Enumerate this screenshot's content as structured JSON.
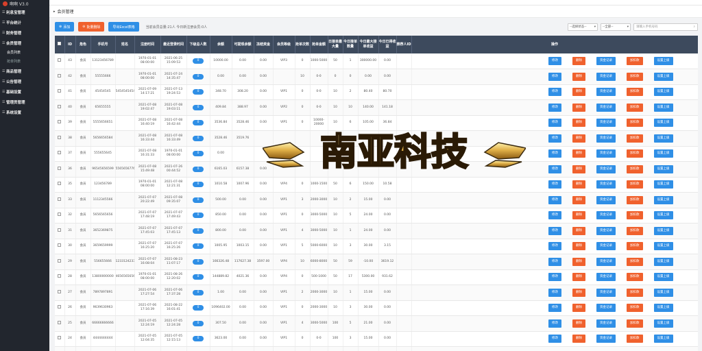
{
  "sidebar": {
    "brand": "啊啊 V3.0",
    "items": [
      {
        "label": "利息宝管理"
      },
      {
        "label": "平台统计"
      },
      {
        "label": "财务管理"
      },
      {
        "label": "会员管理"
      },
      {
        "label": "商品管理"
      },
      {
        "label": "公告管理"
      },
      {
        "label": "基础设置"
      },
      {
        "label": "管理员管理"
      },
      {
        "label": "系统设置"
      }
    ],
    "subitems": [
      {
        "label": "会员列表"
      },
      {
        "label": "抢单列表"
      }
    ]
  },
  "breadcrumb": {
    "title": "会员管理"
  },
  "toolbar": {
    "add_label": "添加",
    "batch_delete_label": "批量删除",
    "export_label": "导出Excel表格",
    "stats_text": "当前会员总量:21人   今日新注册会员:0人",
    "status_select": "--选择状态--",
    "all_select": "--全部--",
    "search_placeholder": "请输入手机号码"
  },
  "table": {
    "headers": [
      "",
      "ID",
      "角色",
      "手机号",
      "姓名",
      "注册时间",
      "最近登录时间",
      "下级总人数",
      "余额",
      "可提现余额",
      "冻结资金",
      "会员等级",
      "抢单次数",
      "抢单金额",
      "日接单最大量",
      "今日接单数量",
      "今日最大接单收益",
      "今日已得收益",
      "推荐人ID",
      "操作"
    ],
    "action_labels": [
      "修改",
      "删除",
      "资金记录",
      "加扣款",
      "设置上级"
    ],
    "rows": [
      {
        "id": "43",
        "role": "会员",
        "phone": "13123456789",
        "name": "",
        "reg": "1970-01-01 08:00:00",
        "login": "2021-06-25 15:09:53",
        "sub": "0",
        "balance": "10000.00",
        "withdraw": "0.00",
        "frozen": "0.00",
        "level": "VIP3",
        "count": "0",
        "amount": "1000-5000",
        "max": "50",
        "today": "1",
        "max_income": "300000.00",
        "income": "0.00",
        "ref": ""
      },
      {
        "id": "42",
        "role": "会员",
        "phone": "55555666",
        "name": "",
        "reg": "1970-01-01 08:00:00",
        "login": "2021-07-24 14:35:47",
        "sub": "0",
        "balance": "0.00",
        "withdraw": "0.00",
        "frozen": "0.00",
        "level": "",
        "count": "10",
        "amount": "0-0",
        "max": "0",
        "today": "0",
        "max_income": "0.00",
        "income": "0.00",
        "ref": ""
      },
      {
        "id": "41",
        "role": "会员",
        "phone": "45454545",
        "name": "5454545454545454",
        "reg": "2021-07-09 14:17:21",
        "login": "2021-07-13 19:24:53",
        "sub": "0",
        "balance": "348.70",
        "withdraw": "308.20",
        "frozen": "0.00",
        "level": "VIP1",
        "count": "0",
        "amount": "0-0",
        "max": "10",
        "today": "2",
        "max_income": "80.40",
        "income": "80.70",
        "ref": ""
      },
      {
        "id": "40",
        "role": "会员",
        "phone": "65655555",
        "name": "",
        "reg": "2021-07-08 19:02:47",
        "login": "2021-07-08 19:03:11",
        "sub": "0",
        "balance": "409.84",
        "withdraw": "388.97",
        "frozen": "0.00",
        "level": "VIP2",
        "count": "0",
        "amount": "0-0",
        "max": "10",
        "today": "10",
        "max_income": "140.00",
        "income": "141.18",
        "ref": ""
      },
      {
        "id": "39",
        "role": "会员",
        "phone": "5555656651",
        "name": "",
        "reg": "2021-07-08 16:40:19",
        "login": "2021-07-08 16:42:44",
        "sub": "0",
        "balance": "3536.84",
        "withdraw": "3528.46",
        "frozen": "0.00",
        "level": "VIP1",
        "count": "0",
        "amount": "10000-20000",
        "max": "10",
        "today": "6",
        "max_income": "105.00",
        "income": "36.84",
        "ref": ""
      },
      {
        "id": "38",
        "role": "会员",
        "phone": "5656656584",
        "name": "",
        "reg": "2021-07-08 16:33:44",
        "login": "2021-07-08 16:33:49",
        "sub": "0",
        "balance": "3528.46",
        "withdraw": "3519.76",
        "frozen": "",
        "level": "",
        "count": "",
        "amount": "",
        "max": "",
        "today": "",
        "max_income": "",
        "income": "",
        "ref": ""
      },
      {
        "id": "37",
        "role": "会员",
        "phone": "555655645",
        "name": "",
        "reg": "2021-07-08 16:31:33",
        "login": "1970-01-01 08:00:00",
        "sub": "0",
        "balance": "0.00",
        "withdraw": "",
        "frozen": "",
        "level": "",
        "count": "",
        "amount": "",
        "max": "",
        "today": "",
        "max_income": "",
        "income": "",
        "ref": ""
      },
      {
        "id": "36",
        "role": "会员",
        "phone": "96545656599",
        "name": "5565656776675",
        "reg": "2021-07-08 15:49:48",
        "login": "2021-07-26 00:44:52",
        "sub": "0",
        "balance": "6165.03",
        "withdraw": "6157.38",
        "frozen": "0.00",
        "level": "",
        "count": "",
        "amount": "",
        "max": "",
        "today": "",
        "max_income": "",
        "income": "",
        "ref": ""
      },
      {
        "id": "35",
        "role": "会员",
        "phone": "123456789",
        "name": "",
        "reg": "1970-01-01 08:00:00",
        "login": "2021-07-08 12:21:31",
        "sub": "0",
        "balance": "1010.58",
        "withdraw": "1007.96",
        "frozen": "0.00",
        "level": "VIP4",
        "count": "0",
        "amount": "1000-1500",
        "max": "50",
        "today": "6",
        "max_income": "150.00",
        "income": "10.58",
        "ref": ""
      },
      {
        "id": "33",
        "role": "会员",
        "phone": "1112345566",
        "name": "",
        "reg": "2021-07-07 20:22:49",
        "login": "2021-07-08 09:35:07",
        "sub": "0",
        "balance": "500.00",
        "withdraw": "0.00",
        "frozen": "0.00",
        "level": "VIP1",
        "count": "3",
        "amount": "2000-3000",
        "max": "10",
        "today": "2",
        "max_income": "15.00",
        "income": "0.00",
        "ref": ""
      },
      {
        "id": "32",
        "role": "会员",
        "phone": "5656565656",
        "name": "",
        "reg": "2021-07-07 17:48:19",
        "login": "2021-07-07 17:49:43",
        "sub": "0",
        "balance": "850.00",
        "withdraw": "0.00",
        "frozen": "0.00",
        "level": "VIP1",
        "count": "0",
        "amount": "3000-5000",
        "max": "10",
        "today": "5",
        "max_income": "24.00",
        "income": "0.00",
        "ref": ""
      },
      {
        "id": "31",
        "role": "会员",
        "phone": "3652369875",
        "name": "",
        "reg": "2021-07-07 17:45:03",
        "login": "2021-07-07 17:45:13",
        "sub": "0",
        "balance": "800.00",
        "withdraw": "0.00",
        "frozen": "0.00",
        "level": "VIP1",
        "count": "4",
        "amount": "3000-5000",
        "max": "10",
        "today": "1",
        "max_income": "24.00",
        "income": "0.00",
        "ref": ""
      },
      {
        "id": "30",
        "role": "会员",
        "phone": "3659659999",
        "name": "",
        "reg": "2021-07-07 16:25:20",
        "login": "2021-07-07 16:25:26",
        "sub": "0",
        "balance": "1005.95",
        "withdraw": "1003.15",
        "frozen": "0.00",
        "level": "VIP1",
        "count": "5",
        "amount": "5000-6000",
        "max": "10",
        "today": "3",
        "max_income": "30.00",
        "income": "3.15",
        "ref": ""
      },
      {
        "id": "29",
        "role": "会员",
        "phone": "556655666",
        "name": "1233124233333665",
        "reg": "2021-07-07 16:08:04",
        "login": "2021-08-23 11:07:17",
        "sub": "0",
        "balance": "166326.48",
        "withdraw": "117627.38",
        "frozen": "3597.00",
        "level": "VIP4",
        "count": "10",
        "amount": "6000-8000",
        "max": "50",
        "today": "59",
        "max_income": "-10.00",
        "income": "3619.12",
        "ref": ""
      },
      {
        "id": "28",
        "role": "会员",
        "phone": "13800000000",
        "name": "46565656565657",
        "reg": "1970-01-01 08:00:00",
        "login": "2021-08-26 12:20:02",
        "sub": "0",
        "balance": "144889.82",
        "withdraw": "4021.36",
        "frozen": "0.00",
        "level": "VIP4",
        "count": "0",
        "amount": "500-1000",
        "max": "50",
        "today": "17",
        "max_income": "5300.00",
        "income": "931.62",
        "ref": ""
      },
      {
        "id": "27",
        "role": "会员",
        "phone": "7897897891",
        "name": "",
        "reg": "2021-07-06 17:27:54",
        "login": "2021-07-06 17:37:28",
        "sub": "0",
        "balance": "1.00",
        "withdraw": "0.00",
        "frozen": "0.00",
        "level": "VIP1",
        "count": "2",
        "amount": "2000-3000",
        "max": "10",
        "today": "1",
        "max_income": "15.00",
        "income": "0.00",
        "ref": ""
      },
      {
        "id": "26",
        "role": "会员",
        "phone": "9639630963",
        "name": "",
        "reg": "2021-07-06 17:16:39",
        "login": "2021-08-22 16:01:41",
        "sub": "0",
        "balance": "1096402.00",
        "withdraw": "0.00",
        "frozen": "0.00",
        "level": "VIP1",
        "count": "0",
        "amount": "2000-3000",
        "max": "10",
        "today": "3",
        "max_income": "30.00",
        "income": "0.00",
        "ref": ""
      },
      {
        "id": "25",
        "role": "会员",
        "phone": "66666666666",
        "name": "",
        "reg": "2021-07-05 12:24:19",
        "login": "2021-07-05 12:24:28",
        "sub": "0",
        "balance": "307.50",
        "withdraw": "0.00",
        "frozen": "0.00",
        "level": "VIP1",
        "count": "4",
        "amount": "3000-5000",
        "max": "100",
        "today": "5",
        "max_income": "21.00",
        "income": "0.00",
        "ref": ""
      },
      {
        "id": "24",
        "role": "会员",
        "phone": "4444444444",
        "name": "",
        "reg": "2021-07-05 12:04:35",
        "login": "2021-07-05 12:15:13",
        "sub": "0",
        "balance": "3623.00",
        "withdraw": "0.00",
        "frozen": "0.00",
        "level": "VIP1",
        "count": "0",
        "amount": "0-0",
        "max": "100",
        "today": "3",
        "max_income": "15.00",
        "income": "0.00",
        "ref": ""
      },
      {
        "id": "",
        "role": "",
        "phone": "",
        "name": "",
        "reg": "",
        "login": "",
        "sub": "",
        "balance": "",
        "withdraw": "",
        "frozen": "",
        "level": "",
        "count": "",
        "amount": "30000-",
        "max": "",
        "today": "",
        "max_income": "",
        "income": "",
        "ref": ""
      }
    ]
  },
  "watermark": {
    "text": "南亚科技"
  },
  "colors": {
    "sidebar": "#22262e",
    "header": "#3d4a5d",
    "blue": "#2f8fe6",
    "orange": "#f0612d",
    "gold": "#d9a441"
  }
}
